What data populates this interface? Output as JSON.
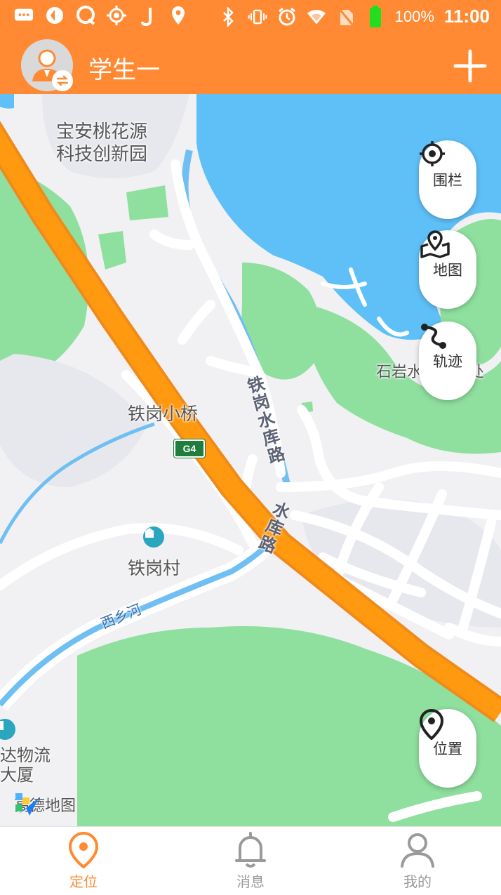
{
  "status_bar": {
    "battery_text": "100%",
    "time": "11:00"
  },
  "header": {
    "title": "学生一",
    "add_icon": "plus-icon"
  },
  "map": {
    "labels": {
      "park": "宝安桃花源\n科技创新园",
      "bridge": "铁岗小桥",
      "village": "铁岗村",
      "road1": "铁岗水库路",
      "road2": "水库路",
      "river": "西乡河",
      "office": "石岩水库管理处",
      "building": "达物流\n大厦",
      "highway": "G4"
    },
    "provider": "高德地图",
    "buttons": {
      "fence": "围栏",
      "map": "地图",
      "track": "轨迹",
      "locate": "位置"
    }
  },
  "tabs": [
    {
      "label": "定位",
      "icon": "location-pin-icon",
      "active": true
    },
    {
      "label": "消息",
      "icon": "bell-icon",
      "active": false
    },
    {
      "label": "我的",
      "icon": "user-icon",
      "active": false
    }
  ],
  "colors": {
    "brand": "#ff8a33",
    "tab_inactive": "#9a9a9a",
    "water": "#5fc0f8",
    "green": "#8fdf9f",
    "highway": "#ff8c00"
  }
}
